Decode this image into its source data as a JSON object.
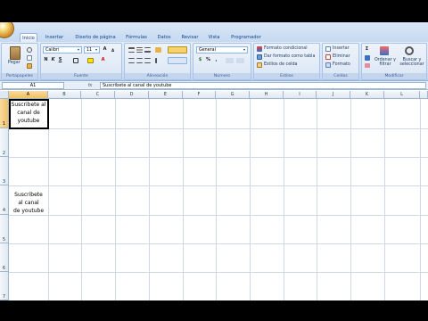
{
  "ribbon": {
    "tabs": [
      "Inicio",
      "Insertar",
      "Diseño de página",
      "Fórmulas",
      "Datos",
      "Revisar",
      "Vista",
      "Programador"
    ],
    "clipboard": {
      "paste": "Pegar",
      "label": "Portapapeles"
    },
    "font": {
      "name": "Calibri",
      "size": "11",
      "label": "Fuente"
    },
    "alignment": {
      "label": "Alineación"
    },
    "number": {
      "format": "General",
      "label": "Número"
    },
    "styles": {
      "conditional": "Formato condicional",
      "as_table": "Dar formato como tabla",
      "cell_styles": "Estilos de celda",
      "label": "Estilos"
    },
    "cells": {
      "insert": "Insertar",
      "delete": "Eliminar",
      "format": "Formato",
      "label": "Celdas"
    },
    "editing": {
      "sort": "Ordenar y filtrar",
      "find": "Buscar y seleccionar",
      "label": "Modificar"
    }
  },
  "formula_bar": {
    "name_box": "A1",
    "fx": "fx",
    "content": "Suscribete al canal de youtube"
  },
  "columns": [
    "A",
    "B",
    "C",
    "D",
    "E",
    "F",
    "G",
    "H",
    "I",
    "J",
    "K",
    "L"
  ],
  "rows": [
    "1",
    "2",
    "3",
    "4",
    "5",
    "6",
    "7"
  ],
  "cells": {
    "a1": "Suscribete al\ncanal de\nyoutube",
    "a4": "Suscribete\nal canal\nde youtube"
  },
  "colors": {
    "ribbon": "#dbe8f7",
    "selected_header": "#f1c15f",
    "gridline": "#d0d7e5"
  }
}
